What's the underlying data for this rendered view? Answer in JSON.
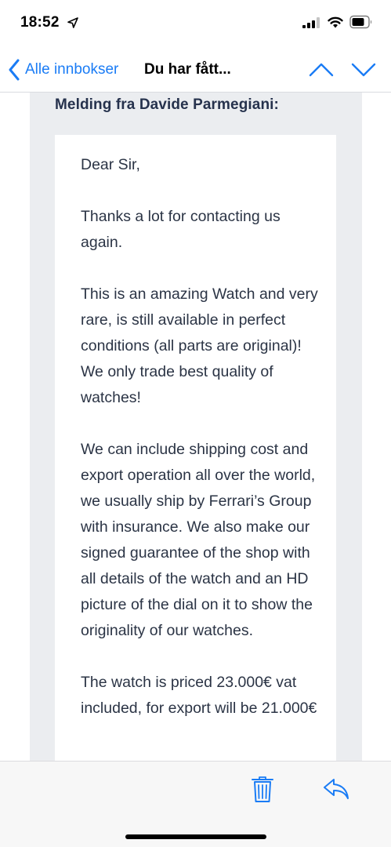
{
  "status_bar": {
    "time": "18:52",
    "location_icon": "location-arrow-icon",
    "signal_icon": "cellular-signal-icon",
    "wifi_icon": "wifi-icon",
    "battery_icon": "battery-icon"
  },
  "nav": {
    "back_label": "Alle innbokser",
    "title": "Du har fått...",
    "up_icon": "chevron-up-icon",
    "down_icon": "chevron-down-icon"
  },
  "message": {
    "quote_header": "Melding fra Davide Parmegiani:",
    "paragraphs": [
      "Dear Sir,",
      "Thanks a lot for contacting us again.",
      "This is an amazing Watch and very rare, is still available in perfect conditions (all parts are original)! We only trade best quality of watches!",
      "We can include shipping cost and export operation all over the world, we usually ship by Ferrari’s Group with insurance. We also make our signed guarantee of the shop with all details of the watch and an HD picture of the dial on it to show the originality of our watches.",
      "The watch is priced 23.000€ vat included, for export will be 21.000€"
    ]
  },
  "toolbar": {
    "trash_icon": "trash-icon",
    "reply_icon": "reply-icon"
  },
  "colors": {
    "accent": "#1a7cf5",
    "quote_background": "#ebedf0",
    "quote_header_text": "#26324d",
    "body_text": "#2b3445",
    "toolbar_background": "#f7f7f7"
  }
}
